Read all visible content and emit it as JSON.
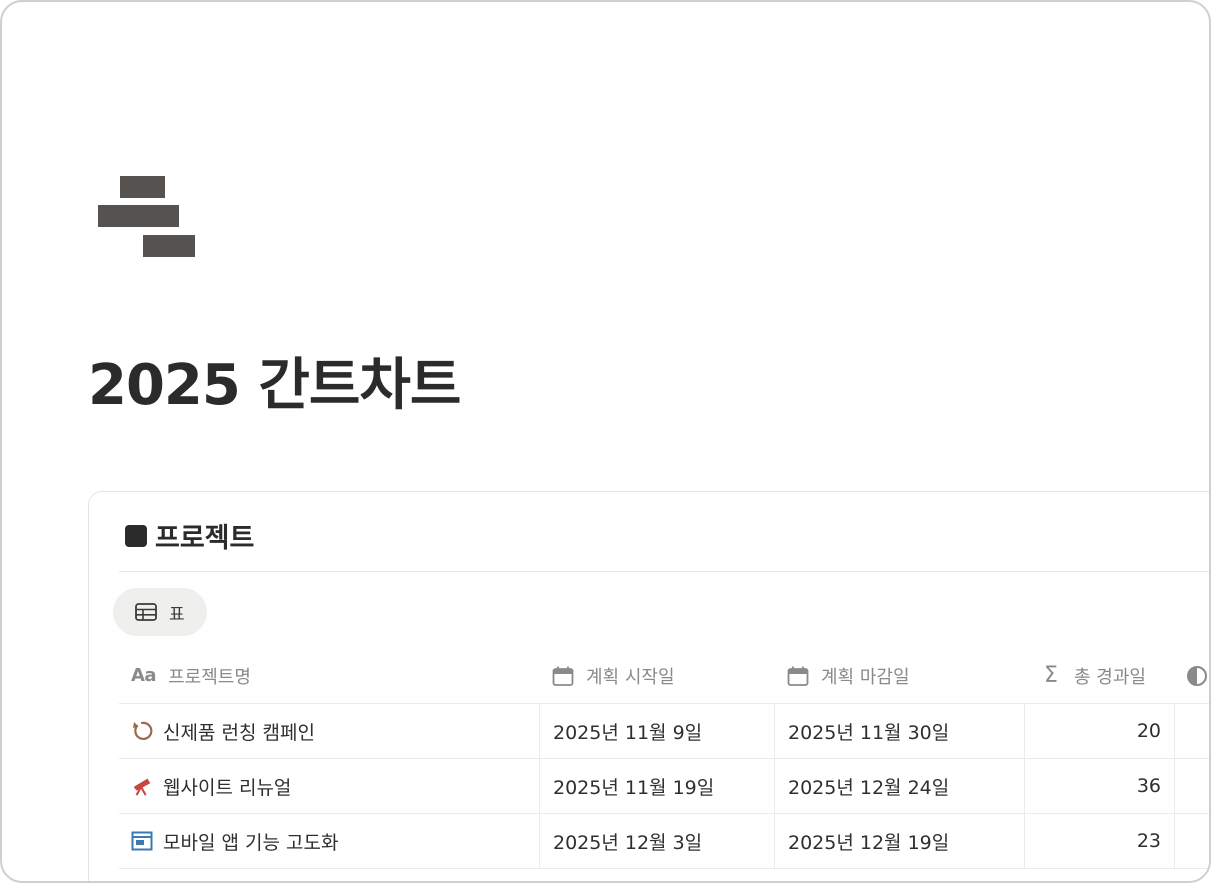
{
  "page": {
    "icon": "gantt-bars-icon",
    "title": "2025 간트차트"
  },
  "database": {
    "title": "프로젝트",
    "view_tab": {
      "icon": "table-icon",
      "label": "표"
    },
    "columns": [
      {
        "icon": "text-property-icon",
        "icon_text": "Aa",
        "label": "프로젝트명"
      },
      {
        "icon": "calendar-icon",
        "label": "계획 시작일"
      },
      {
        "icon": "calendar-icon",
        "label": "계획 마감일"
      },
      {
        "icon": "sigma-icon",
        "label": "총 경과일"
      },
      {
        "icon": "progress-circle-icon",
        "label": ""
      }
    ],
    "rows": [
      {
        "icon": "refresh-arrow-icon",
        "icon_color": "#9a6a4a",
        "name": "신제품 런칭 캠페인",
        "start": "2025년 11월 9일",
        "end": "2025년 11월 30일",
        "days": "20"
      },
      {
        "icon": "telescope-icon",
        "icon_color": "#c8463f",
        "name": "웹사이트 리뉴얼",
        "start": "2025년 11월 19일",
        "end": "2025년 12월 24일",
        "days": "36"
      },
      {
        "icon": "browser-window-icon",
        "icon_color": "#3a7ab0",
        "name": "모바일 앱 기능 고도화",
        "start": "2025년 12월 3일",
        "end": "2025년 12월 19일",
        "days": "23"
      }
    ]
  }
}
